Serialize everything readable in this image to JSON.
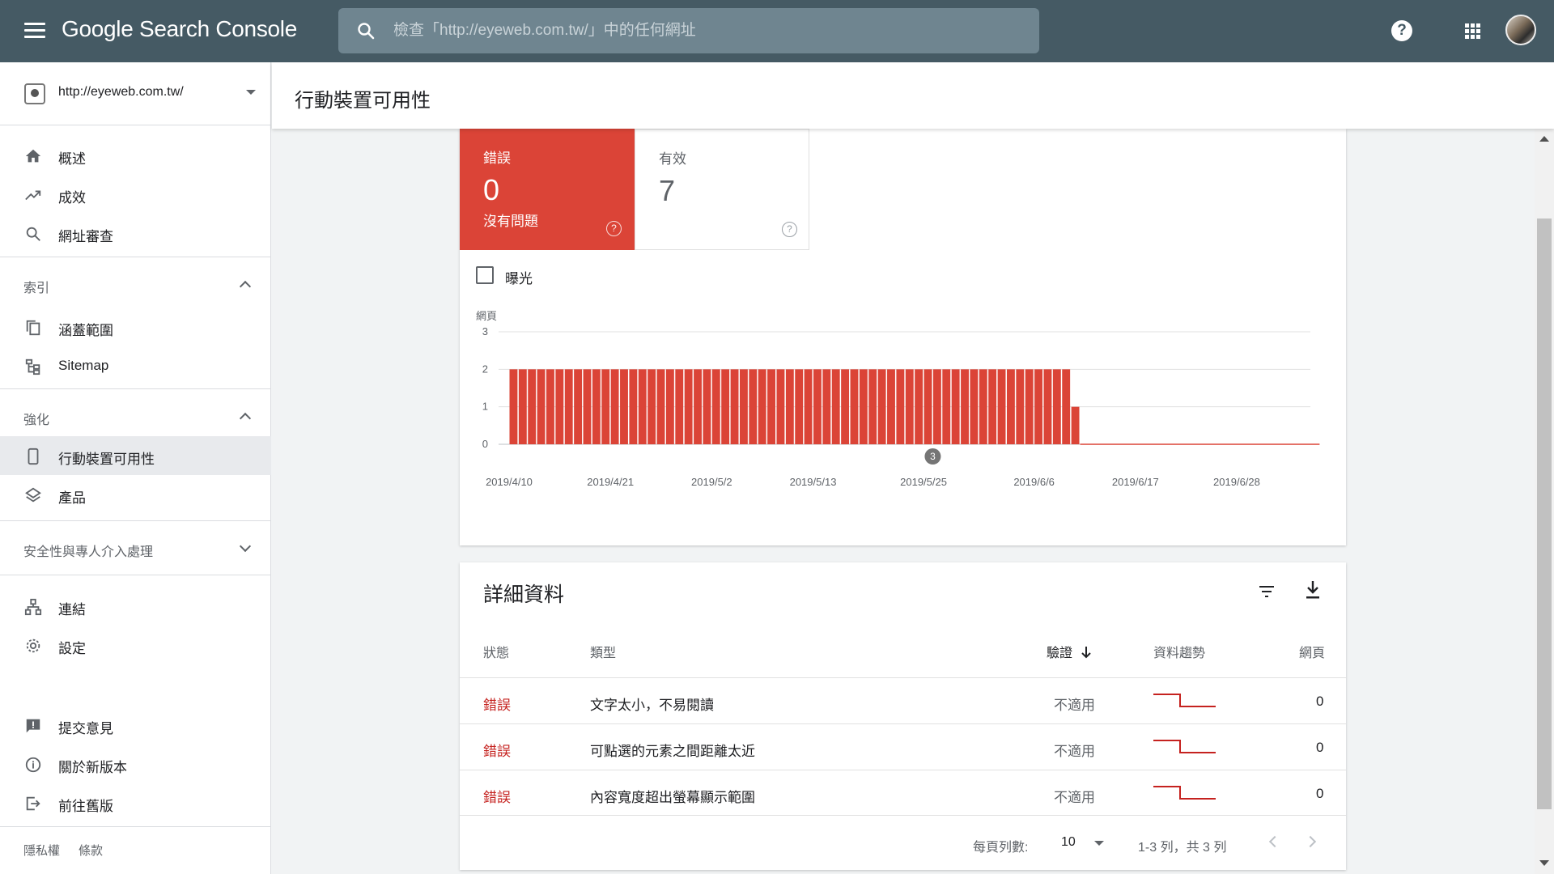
{
  "app": {
    "name": "Google Search Console",
    "search_placeholder": "檢查「http://eyeweb.com.tw/」中的任何網址",
    "help_label": "?"
  },
  "property": {
    "url": "http://eyeweb.com.tw/"
  },
  "sidebar": {
    "top_items": [
      {
        "label": "概述",
        "icon": "home-icon"
      },
      {
        "label": "成效",
        "icon": "trending-up-icon"
      },
      {
        "label": "網址審查",
        "icon": "search-icon"
      }
    ],
    "index_section": {
      "label": "索引",
      "items": [
        {
          "label": "涵蓋範圍",
          "icon": "file-copy-icon"
        },
        {
          "label": "Sitemap",
          "icon": "sitemap-icon"
        }
      ]
    },
    "enhancements_section": {
      "label": "強化",
      "items": [
        {
          "label": "行動裝置可用性",
          "icon": "smartphone-icon",
          "active": true
        },
        {
          "label": "產品",
          "icon": "layers-icon"
        }
      ]
    },
    "security_section": {
      "label": "安全性與專人介入處理"
    },
    "misc_items": [
      {
        "label": "連結",
        "icon": "network-icon"
      },
      {
        "label": "設定",
        "icon": "gear-icon"
      }
    ],
    "bottom_items": [
      {
        "label": "提交意見",
        "icon": "feedback-icon"
      },
      {
        "label": "關於新版本",
        "icon": "info-icon"
      },
      {
        "label": "前往舊版",
        "icon": "exit-icon"
      }
    ],
    "footer": {
      "privacy": "隱私權",
      "terms": "條款"
    }
  },
  "page": {
    "title": "行動裝置可用性"
  },
  "summary": {
    "error": {
      "label": "錯誤",
      "count": "0",
      "sub": "沒有問題",
      "color": "#db4437"
    },
    "valid": {
      "label": "有效",
      "count": "7"
    },
    "impressions_label": "曝光"
  },
  "chart_data": {
    "type": "bar",
    "ylabel": "網頁",
    "ylim": [
      0,
      3
    ],
    "yticks": [
      "0",
      "1",
      "2",
      "3"
    ],
    "xtick_labels": [
      "2019/4/10",
      "2019/4/21",
      "2019/5/2",
      "2019/5/13",
      "2019/5/25",
      "2019/6/6",
      "2019/6/17",
      "2019/6/28"
    ],
    "x_start": "2019/4/10",
    "x_end": "2019/7/6",
    "bar_color": "#db4437",
    "series": [
      {
        "values": [
          2,
          2,
          2,
          2,
          2,
          2,
          2,
          2,
          2,
          2,
          2,
          2,
          2,
          2,
          2,
          2,
          2,
          2,
          2,
          2,
          2,
          2,
          2,
          2,
          2,
          2,
          2,
          2,
          2,
          2,
          2,
          2,
          2,
          2,
          2,
          2,
          2,
          2,
          2,
          2,
          2,
          2,
          2,
          2,
          2,
          2,
          2,
          2,
          2,
          2,
          2,
          2,
          2,
          2,
          2,
          2,
          2,
          2,
          2,
          2,
          2,
          1,
          0,
          0,
          0,
          0,
          0,
          0,
          0,
          0,
          0,
          0,
          0,
          0,
          0,
          0,
          0,
          0,
          0,
          0,
          0,
          0,
          0,
          0,
          0,
          0,
          0,
          0
        ]
      }
    ],
    "annotation": {
      "label": "3",
      "date": "2019/5/26"
    }
  },
  "details": {
    "title": "詳細資料",
    "columns": [
      "狀態",
      "類型",
      "驗證",
      "資料趨勢",
      "網頁"
    ],
    "rows": [
      {
        "status": "錯誤",
        "type": "文字太小，不易閱讀",
        "validation": "不適用",
        "pages": "0"
      },
      {
        "status": "錯誤",
        "type": "可點選的元素之間距離太近",
        "validation": "不適用",
        "pages": "0"
      },
      {
        "status": "錯誤",
        "type": "內容寬度超出螢幕顯示範圍",
        "validation": "不適用",
        "pages": "0"
      }
    ],
    "pagination": {
      "rows_per_page_label": "每頁列數:",
      "rows_per_page": "10",
      "range": "1-3 列，共 3 列"
    }
  }
}
